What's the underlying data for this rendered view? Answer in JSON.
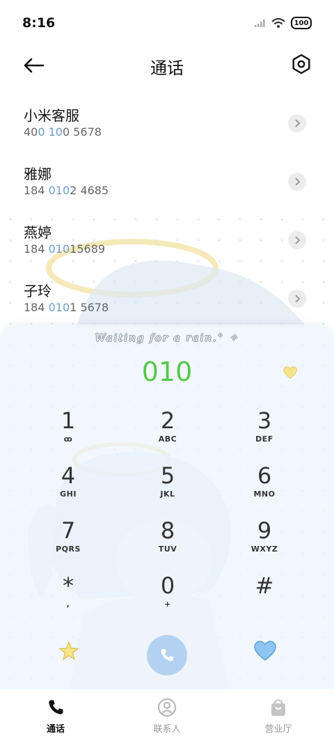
{
  "status_bar": {
    "time": "8:16",
    "battery": "100"
  },
  "header": {
    "title": "通话"
  },
  "recent_calls": [
    {
      "name": "小米客服",
      "number_parts": [
        "40",
        "0 10",
        "0 5678"
      ]
    },
    {
      "name": "雅娜",
      "number_parts": [
        "184 ",
        "010",
        "2 4685"
      ]
    },
    {
      "name": "燕婷",
      "number_parts": [
        "184 ",
        "010",
        "15689"
      ]
    },
    {
      "name": "子玲",
      "number_parts": [
        "184 ",
        "010",
        "1 5678"
      ]
    }
  ],
  "dialpad": {
    "signature": "Waiting for a rain.° ✧",
    "entered_number": "010",
    "keys": [
      {
        "digit": "1",
        "letters": "ꝏ"
      },
      {
        "digit": "2",
        "letters": "ABC"
      },
      {
        "digit": "3",
        "letters": "DEF"
      },
      {
        "digit": "4",
        "letters": "GHI"
      },
      {
        "digit": "5",
        "letters": "JKL"
      },
      {
        "digit": "6",
        "letters": "MNO"
      },
      {
        "digit": "7",
        "letters": "PQRS"
      },
      {
        "digit": "8",
        "letters": "TUV"
      },
      {
        "digit": "9",
        "letters": "WXYZ"
      },
      {
        "digit": "*",
        "letters": ","
      },
      {
        "digit": "0",
        "letters": "+"
      },
      {
        "digit": "#",
        "letters": ""
      }
    ]
  },
  "bottom_nav": [
    {
      "label": "通话",
      "icon": "phone-icon",
      "active": true
    },
    {
      "label": "联系人",
      "icon": "contacts-icon",
      "active": false
    },
    {
      "label": "营业厅",
      "icon": "shopping-bag-icon",
      "active": false
    }
  ],
  "colors": {
    "highlight_digits": "#6f9cc8",
    "entered_number": "#56c64d",
    "call_button": "#b3d2f1",
    "heart": "#8ec5f3"
  }
}
